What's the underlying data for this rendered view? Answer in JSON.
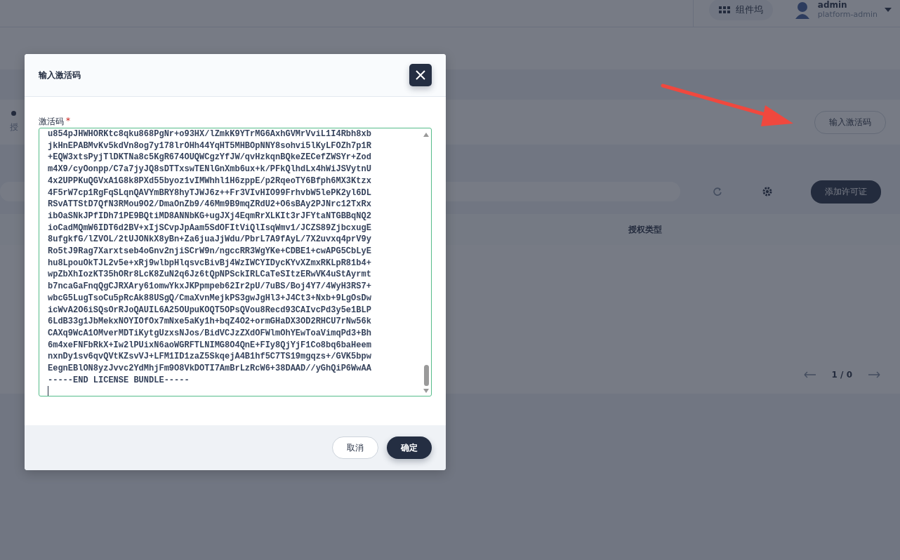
{
  "header": {
    "components_button": "组件坞",
    "user": {
      "name": "admin",
      "role": "platform-admin"
    }
  },
  "license_card": {
    "title_fragment": "授",
    "button": "输入激活码"
  },
  "toolbar": {
    "add_button": "添加许可证"
  },
  "table": {
    "columns": [
      "授权类型"
    ]
  },
  "pagination": {
    "page": "1 / 0"
  },
  "dialog": {
    "title": "输入激活码",
    "field_label": "激活码",
    "required_mark": "*",
    "value_lines": [
      "u854pJHWHORKtc8qku868PgNr+o93HX/lZmkK9YTrMG6AxhGVMrVviL1I4Rbh8xb",
      "jkHnEPABMvKv5kdVn8og7y178lrOHh44YqHT5MHBOpNNY8sohvi5lKyLFOZh7p1R",
      "+EQW3xtsPyjTlDKTNa8c5KgR674OUQWCgzYfJW/qvHzkqnBQkeZECefZWSYr+Zod",
      "m4X9/cyOonpp/C7a7jyJQ8sDTTxswTENlGnXmb6ux+k/PFkQlhdLx4hWiJSVytnU",
      "4x2UPPKuQGVxA1G8k8PXd55byoz1vIMWhhl1H6zppE/p2RqeoTY6Bfph6MX3Ktzx",
      "4F5rW7cp1RgFqSLqnQAVYmBRY8hyTJWJ6z++Fr3VIvHIO99FrhvbW5lePK2yl6DL",
      "RSvATTStD7QfN3RMou9O2/DmaOnZb9/46Mm9B9mqZRdU2+O6sBAy2PJNrc12TxRx",
      "ibOaSNkJPfIDh71PE9BQtiMD8ANNbKG+ugJXj4EqmRrXLKIt3rJFYtaNTGBBqNQ2",
      "ioCadMQmW6IDT6d2BV+xIjSCvpJpAam5SdOFItViQlIsqWmv1/JCZS89ZjbcxugE",
      "8ufgkfG/lZVOL/2tUJONkX8yBn+Za6juaJjWdu/PbrL7A9fAyL/7X2uvxq4prV9y",
      "Ro5tJ9Rag7Xarxtseb4oGnv2njiSCrW9n/ngccRR3WgYKe+CDBE1+cwAPG5CbLyE",
      "hu8LpouOkTJL2v5e+xRj9wlbpHlqsvcBivBj4WzIWCYIDycKYvXZmxRKLpR81b4+",
      "wpZbXhIozKT35hORr8LcK8ZuN2q6Jz6tQpNPSckIRLCaTeSItzERwVK4uStAyrmt",
      "b7ncaGaFnqQgCJRXAry61omwYkxJKPpmpeb62Ir2pU/7uBS/Boj4Y7/4WyH3RS7+",
      "wbcG5LugTsoCu5pRcAk88USgQ/CmaXvnMejkPS3gwJgHl3+J4Ct3+Nxb+9LgOsDw",
      "icWvA2O6iSQsOrRJoQAUIL6A25OUpuKOQT5OPsQVou8Recd93CAIvcPd3y5e1BLP",
      "6LdB33g1JbMekxNOYIOfOx7mNxe5aKy1h+bqZ4O2+ormGHaDX3OD2RHCU7rNw56k",
      "CAXq9WcA1OMverMDTiKytgUzxsNJos/BidVCJzZXdOFWlmOhYEwToaVimqPd3+Bh",
      "6m4xeFNFbRkX+Iw2lPUixN6aoWGRFTLNIMG8O4QnE+FIy8QjYjF1Co8bq6baHeem",
      "nxnDy1sv6qvQVtKZsvVJ+LFM1ID1zaZ5SkqejA4B1hf5C7TS19mgqzs+/GVK5bpw",
      "EegnEBlON8yzJvvc2YdMhjFm9O8VkDOTI7AmBrLzRcW6+38DAAD//yGhQiP6WwAA",
      "-----END LICENSE BUNDLE-----"
    ],
    "buttons": [
      {
        "label": "取消",
        "kind": "secondary"
      },
      {
        "label": "确定",
        "kind": "primary"
      }
    ]
  }
}
